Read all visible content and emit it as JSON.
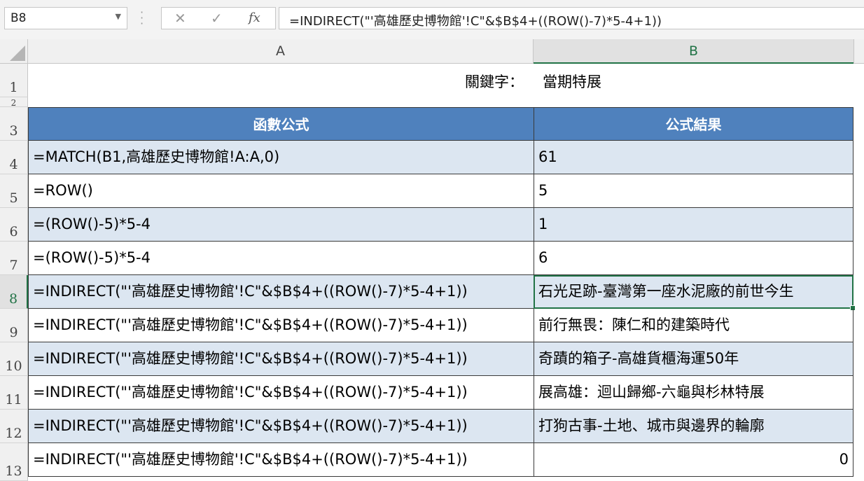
{
  "formula_bar": {
    "name_box": "B8",
    "cancel_glyph": "✕",
    "enter_glyph": "✓",
    "fx_label": "fx",
    "formula": "=INDIRECT(\"'高雄歷史博物館'!C\"&$B$4+((ROW()-7)*5-4+1))"
  },
  "columns": [
    "A",
    "B"
  ],
  "rows": [
    "1",
    "2",
    "3",
    "4",
    "5",
    "6",
    "7",
    "8",
    "9",
    "10",
    "11",
    "12",
    "13"
  ],
  "keyword": {
    "label": "關鍵字：",
    "value": "當期特展"
  },
  "table": {
    "headers": [
      "函數公式",
      "公式結果"
    ],
    "rows": [
      {
        "formula": "=MATCH(B1,高雄歷史博物館!A:A,0)",
        "result": "61"
      },
      {
        "formula": "=ROW()",
        "result": "5"
      },
      {
        "formula": "=(ROW()-5)*5-4",
        "result": "1"
      },
      {
        "formula": "=(ROW()-5)*5-4",
        "result": "6"
      },
      {
        "formula": "=INDIRECT(\"'高雄歷史博物館'!C\"&$B$4+((ROW()-7)*5-4+1))",
        "result": "石光足跡-臺灣第一座水泥廠的前世今生"
      },
      {
        "formula": "=INDIRECT(\"'高雄歷史博物館'!C\"&$B$4+((ROW()-7)*5-4+1))",
        "result": "前行無畏：陳仁和的建築時代"
      },
      {
        "formula": "=INDIRECT(\"'高雄歷史博物館'!C\"&$B$4+((ROW()-7)*5-4+1))",
        "result": "奇蹟的箱子-高雄貨櫃海運50年"
      },
      {
        "formula": "=INDIRECT(\"'高雄歷史博物館'!C\"&$B$4+((ROW()-7)*5-4+1))",
        "result": "展高雄：迴山歸鄉-六龜與杉林特展"
      },
      {
        "formula": "=INDIRECT(\"'高雄歷史博物館'!C\"&$B$4+((ROW()-7)*5-4+1))",
        "result": "打狗古事-土地、城市與邊界的輪廓"
      },
      {
        "formula": "=INDIRECT(\"'高雄歷史博物館'!C\"&$B$4+((ROW()-7)*5-4+1))",
        "result": "0"
      }
    ]
  },
  "colors": {
    "header_fill": "#4f81bd",
    "band_fill": "#dce6f1",
    "selection": "#217346"
  }
}
